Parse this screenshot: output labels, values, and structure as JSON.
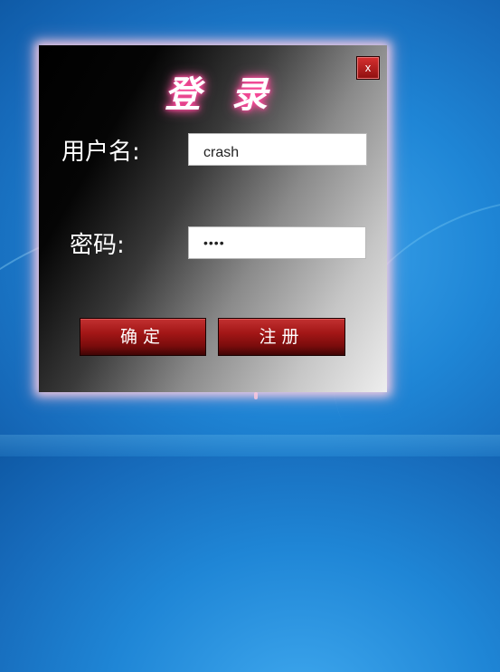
{
  "dialog": {
    "title": "登 录",
    "close_label": "x",
    "username_label": "用户名:",
    "username_value": "crash",
    "password_label": "密码:",
    "password_value": "••••",
    "confirm_label": "确定",
    "register_label": "注册"
  },
  "colors": {
    "button_red": "#a21616",
    "title_glow": "#ff3b90",
    "desktop_blue": "#1f86d6"
  }
}
